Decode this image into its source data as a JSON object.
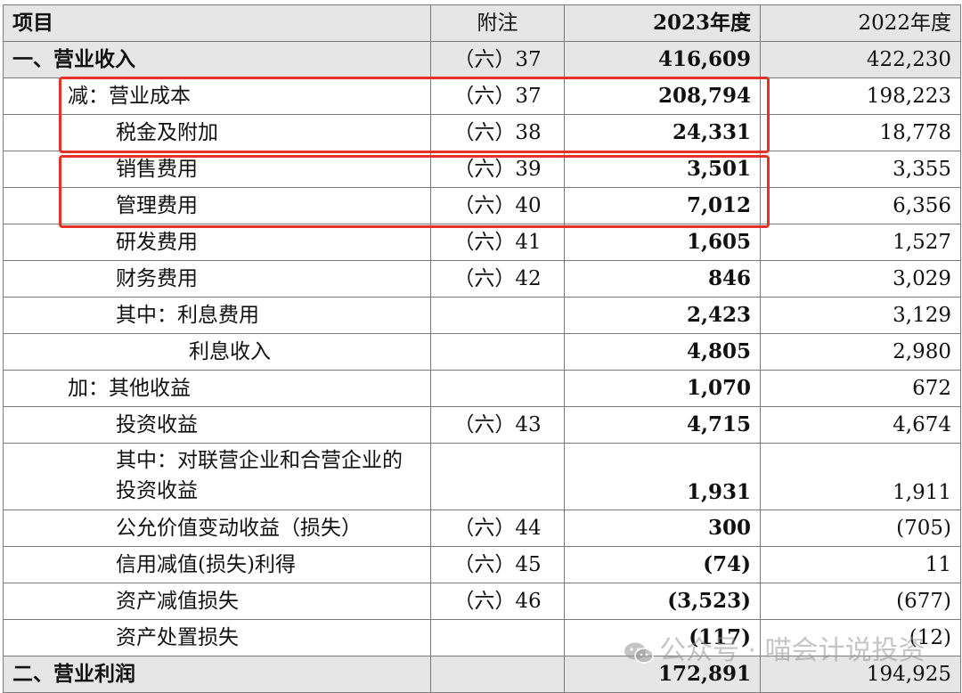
{
  "header": {
    "item": "项目",
    "note": "附注",
    "y2023": "2023年度",
    "y2022": "2022年度"
  },
  "rows": [
    {
      "item": "一、营业收入",
      "note": "（六）37",
      "v2023": "416,609",
      "v2022": "422,230"
    },
    {
      "item": "减：营业成本",
      "note": "（六）37",
      "v2023": "208,794",
      "v2022": "198,223"
    },
    {
      "item": "税金及附加",
      "note": "（六）38",
      "v2023": "24,331",
      "v2022": "18,778"
    },
    {
      "item": "销售费用",
      "note": "（六）39",
      "v2023": "3,501",
      "v2022": "3,355"
    },
    {
      "item": "管理费用",
      "note": "（六）40",
      "v2023": "7,012",
      "v2022": "6,356"
    },
    {
      "item": "研发费用",
      "note": "（六）41",
      "v2023": "1,605",
      "v2022": "1,527"
    },
    {
      "item": "财务费用",
      "note": "（六）42",
      "v2023": "846",
      "v2022": "3,029"
    },
    {
      "item": "其中：利息费用",
      "note": "",
      "v2023": "2,423",
      "v2022": "3,129"
    },
    {
      "item": "利息收入",
      "note": "",
      "v2023": "4,805",
      "v2022": "2,980"
    },
    {
      "item": "加：其他收益",
      "note": "",
      "v2023": "1,070",
      "v2022": "672"
    },
    {
      "item": "投资收益",
      "note": "（六）43",
      "v2023": "4,715",
      "v2022": "4,674"
    },
    {
      "item": "其中：对联营企业和合营企业的投资收益",
      "note": "",
      "v2023": "1,931",
      "v2022": "1,911"
    },
    {
      "item": "公允价值变动收益（损失）",
      "note": "（六）44",
      "v2023": "300",
      "v2022": "(705)"
    },
    {
      "item": "信用减值(损失)利得",
      "note": "（六）45",
      "v2023": "(74)",
      "v2022": "11"
    },
    {
      "item": "资产减值损失",
      "note": "（六）46",
      "v2023": "(3,523)",
      "v2022": "(677)"
    },
    {
      "item": "资产处置损失",
      "note": "",
      "v2023": "(117)",
      "v2022": "(12)"
    },
    {
      "item": "二、营业利润",
      "note": "",
      "v2023": "172,891",
      "v2022": "194,925"
    }
  ],
  "watermark": {
    "text": "公众号 · 喵会计说投资",
    "icon": "wechat-icon"
  },
  "highlight_color": "#e53228"
}
